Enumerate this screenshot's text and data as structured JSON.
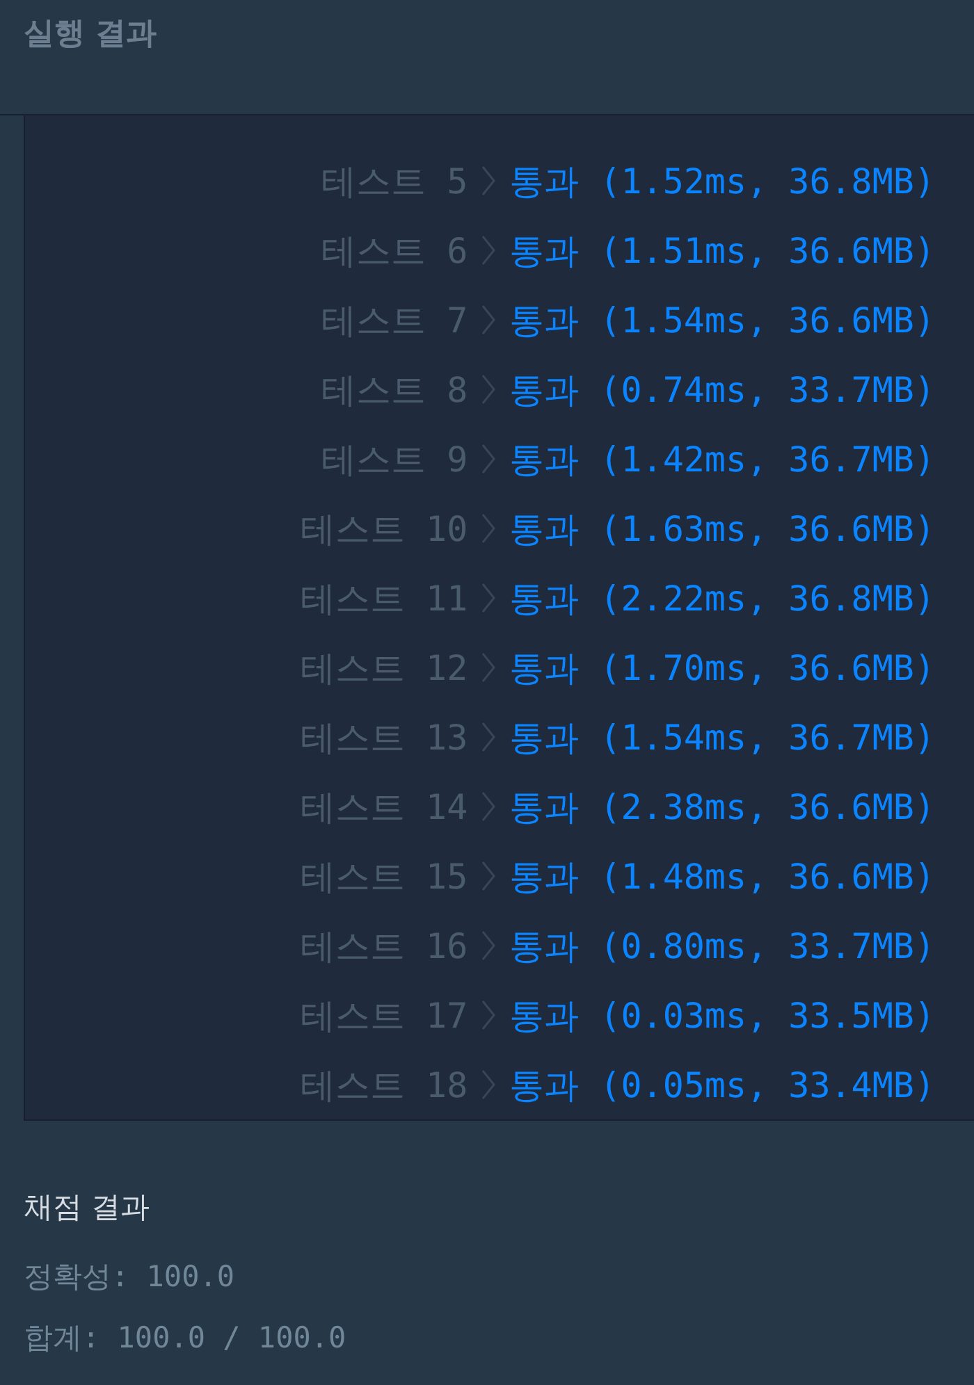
{
  "header": {
    "title": "실행 결과"
  },
  "tests": [
    {
      "label": "테스트",
      "number": "5",
      "result": "통과",
      "detail": "(1.52ms, 36.8MB)",
      "passed": true
    },
    {
      "label": "테스트",
      "number": "6",
      "result": "통과",
      "detail": "(1.51ms, 36.6MB)",
      "passed": true
    },
    {
      "label": "테스트",
      "number": "7",
      "result": "통과",
      "detail": "(1.54ms, 36.6MB)",
      "passed": true
    },
    {
      "label": "테스트",
      "number": "8",
      "result": "통과",
      "detail": "(0.74ms, 33.7MB)",
      "passed": true
    },
    {
      "label": "테스트",
      "number": "9",
      "result": "통과",
      "detail": "(1.42ms, 36.7MB)",
      "passed": true
    },
    {
      "label": "테스트",
      "number": "10",
      "result": "통과",
      "detail": "(1.63ms, 36.6MB)",
      "passed": true
    },
    {
      "label": "테스트",
      "number": "11",
      "result": "통과",
      "detail": "(2.22ms, 36.8MB)",
      "passed": true
    },
    {
      "label": "테스트",
      "number": "12",
      "result": "통과",
      "detail": "(1.70ms, 36.6MB)",
      "passed": true
    },
    {
      "label": "테스트",
      "number": "13",
      "result": "통과",
      "detail": "(1.54ms, 36.7MB)",
      "passed": true
    },
    {
      "label": "테스트",
      "number": "14",
      "result": "통과",
      "detail": "(2.38ms, 36.6MB)",
      "passed": true
    },
    {
      "label": "테스트",
      "number": "15",
      "result": "통과",
      "detail": "(1.48ms, 36.6MB)",
      "passed": true
    },
    {
      "label": "테스트",
      "number": "16",
      "result": "통과",
      "detail": "(0.80ms, 33.7MB)",
      "passed": true
    },
    {
      "label": "테스트",
      "number": "17",
      "result": "통과",
      "detail": "(0.03ms, 33.5MB)",
      "passed": true
    },
    {
      "label": "테스트",
      "number": "18",
      "result": "통과",
      "detail": "(0.05ms, 33.4MB)",
      "passed": true
    }
  ],
  "grading": {
    "title": "채점 결과",
    "lines": [
      "정확성: 100.0",
      "합계: 100.0 / 100.0"
    ]
  }
}
